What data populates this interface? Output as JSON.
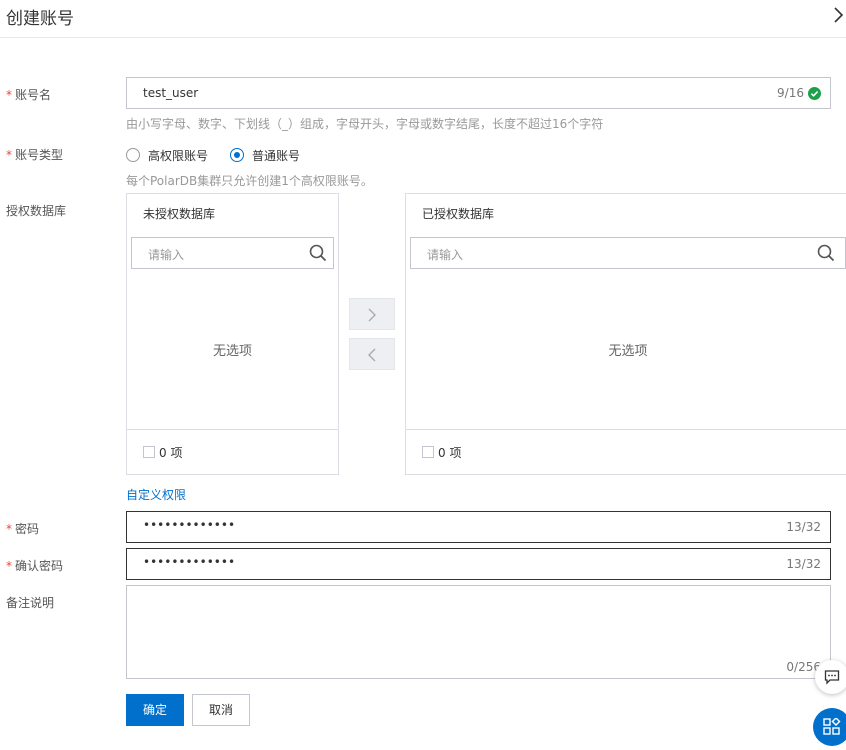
{
  "header": {
    "title": "创建账号",
    "close_icon": "chevron-right-icon"
  },
  "colors": {
    "primary": "#0070cc",
    "required": "#e84738",
    "success": "#1e9f4b",
    "border": "#c4c6cf"
  },
  "form": {
    "account_name": {
      "label": "账号名",
      "value": "test_user",
      "count": "9/16",
      "status_icon": "check-circle-icon",
      "help": "由小写字母、数字、下划线（_）组成，字母开头，字母或数字结尾，长度不超过16个字符"
    },
    "account_type": {
      "label": "账号类型",
      "options": [
        {
          "label": "高权限账号",
          "checked": false
        },
        {
          "label": "普通账号",
          "checked": true
        }
      ],
      "help": "每个PolarDB集群只允许创建1个高权限账号。"
    },
    "databases": {
      "label": "授权数据库",
      "left": {
        "title": "未授权数据库",
        "placeholder": "请输入",
        "empty": "无选项",
        "count": "0 项"
      },
      "right": {
        "title": "已授权数据库",
        "placeholder": "请输入",
        "empty": "无选项",
        "count": "0 项"
      },
      "move_right_icon": "chevron-right-icon",
      "move_left_icon": "chevron-left-icon"
    },
    "custom_permission_link": "自定义权限",
    "password": {
      "label": "密码",
      "masked": "•••••••••••••",
      "count": "13/32"
    },
    "confirm_password": {
      "label": "确认密码",
      "masked": "•••••••••••••",
      "count": "13/32"
    },
    "remark": {
      "label": "备注说明",
      "count": "0/256"
    }
  },
  "actions": {
    "confirm": "确定",
    "cancel": "取消"
  },
  "floating": {
    "chat_icon": "chat-icon",
    "apps_icon": "apps-grid-icon"
  }
}
